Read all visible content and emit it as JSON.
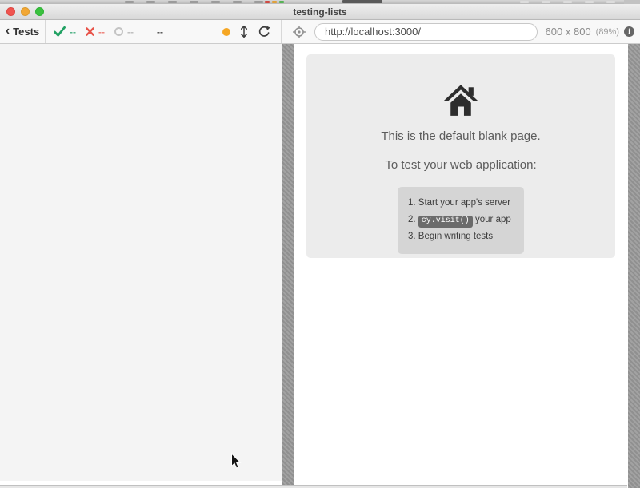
{
  "window": {
    "title": "testing-lists"
  },
  "toolbar": {
    "back_button": "Tests",
    "stats": {
      "passed_value": "--",
      "failed_value": "--",
      "pending_value": "--",
      "duration_value": "--"
    },
    "url": "http://localhost:3000/",
    "viewport_size": "600 x 800",
    "viewport_scale": "(89%)"
  },
  "icons": {
    "chevron_left": "‹",
    "info_glyph": "i"
  },
  "aut_page": {
    "heading": "This is the default blank page.",
    "subheading": "To test your web application:",
    "steps": [
      {
        "num": "1.",
        "text": "Start your app's server"
      },
      {
        "num": "2.",
        "code": "cy.visit()",
        "text": "your app"
      },
      {
        "num": "3.",
        "text": "Begin writing tests"
      }
    ]
  },
  "colors": {
    "pass_green": "#21a163",
    "fail_red": "#e8544a",
    "pending_gray": "#c4c4c4",
    "viewport_dot_yellow": "#f5a623"
  }
}
